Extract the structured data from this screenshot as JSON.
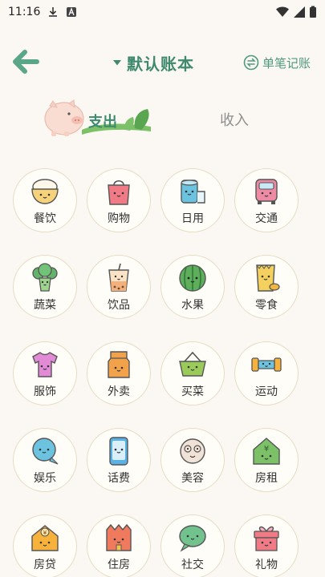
{
  "status_bar": {
    "time": "11:16"
  },
  "header": {
    "book_title": "默认账本",
    "single_entry_label": "单笔记账"
  },
  "tabs": {
    "expense": "支出",
    "income": "收入"
  },
  "categories": [
    {
      "label": "餐饮",
      "icon": "rice-bowl-icon",
      "color": "#f6d37a"
    },
    {
      "label": "购物",
      "icon": "shopping-bag-icon",
      "color": "#f07a86"
    },
    {
      "label": "日用",
      "icon": "toilet-paper-icon",
      "color": "#6cc3e0"
    },
    {
      "label": "交通",
      "icon": "bus-icon",
      "color": "#ef8aa5"
    },
    {
      "label": "蔬菜",
      "icon": "broccoli-icon",
      "color": "#63b36a"
    },
    {
      "label": "饮品",
      "icon": "bubble-tea-icon",
      "color": "#f3b07a"
    },
    {
      "label": "水果",
      "icon": "watermelon-icon",
      "color": "#5fae5c"
    },
    {
      "label": "零食",
      "icon": "snack-icon",
      "color": "#f4d15f"
    },
    {
      "label": "服饰",
      "icon": "tshirt-icon",
      "color": "#e38ad6"
    },
    {
      "label": "外卖",
      "icon": "takeout-bag-icon",
      "color": "#f2a24a"
    },
    {
      "label": "买菜",
      "icon": "basket-icon",
      "color": "#9acb5a"
    },
    {
      "label": "运动",
      "icon": "dumbbell-icon",
      "color": "#f6b23a"
    },
    {
      "label": "娱乐",
      "icon": "chat-bubble-icon",
      "color": "#6cc3e0"
    },
    {
      "label": "话费",
      "icon": "phone-icon",
      "color": "#5ab1e6"
    },
    {
      "label": "美容",
      "icon": "face-icon",
      "color": "#f0e2d6"
    },
    {
      "label": "房租",
      "icon": "house-icon",
      "color": "#7cc067"
    },
    {
      "label": "房贷",
      "icon": "house-yen-icon",
      "color": "#f6b23a"
    },
    {
      "label": "住房",
      "icon": "apartment-icon",
      "color": "#f07a5e"
    },
    {
      "label": "社交",
      "icon": "social-bubble-icon",
      "color": "#72c28e"
    },
    {
      "label": "礼物",
      "icon": "gift-icon",
      "color": "#f07a86"
    }
  ],
  "colors": {
    "brand": "#3f8a6f",
    "background": "#fbf8f3"
  }
}
